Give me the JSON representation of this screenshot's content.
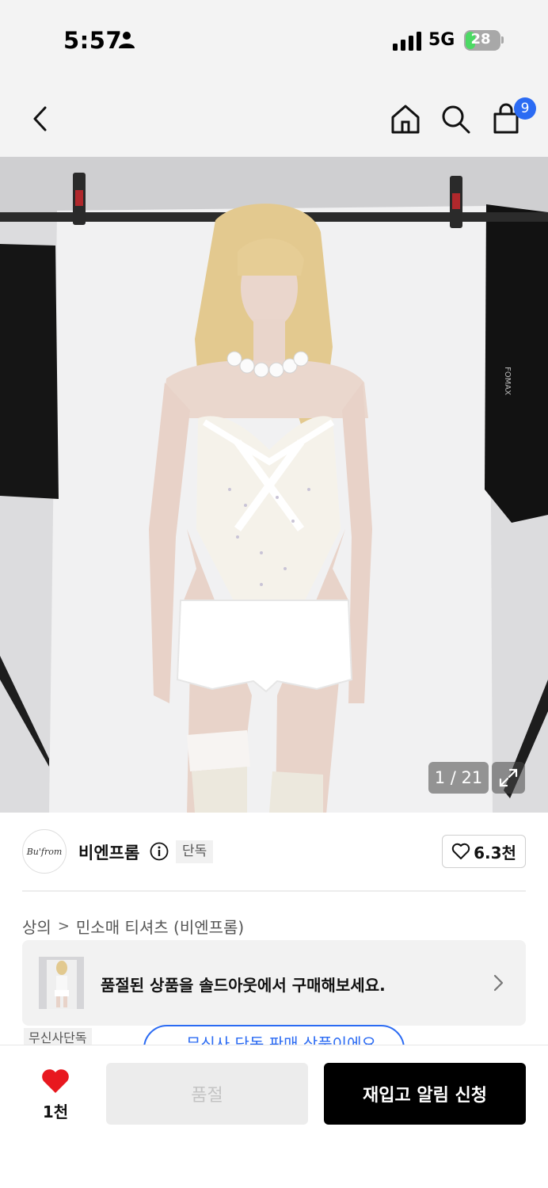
{
  "status_bar": {
    "time": "5:57",
    "network": "5G",
    "battery": "28",
    "battery_percent": 28
  },
  "nav": {
    "cart_count": "9",
    "icons": [
      "back-icon",
      "home-icon",
      "search-icon",
      "cart-icon"
    ]
  },
  "gallery": {
    "counter": "1 / 21"
  },
  "brand": {
    "logo_text": "Bu'from",
    "name": "비엔프롬",
    "exclusive_tag": "단독",
    "likes": "6.3천"
  },
  "breadcrumb": {
    "category": "상의",
    "subcategory": "민소매 티셔츠 (비엔프롬)"
  },
  "soldout_banner": {
    "text": "품절된 상품을 솔드아웃에서 구매해보세요."
  },
  "badges": {
    "musinsa_exclusive": "무신사단독",
    "exclusive_sale": "무신사 단독 판매 상품이에요"
  },
  "bottom_bar": {
    "wish_count": "1천",
    "soldout_label": "품절",
    "restock_label": "재입고 알림 신청"
  },
  "colors": {
    "accent_blue": "#2b6bf3",
    "heart_red": "#e8181f",
    "battery_green": "#4cd964"
  }
}
